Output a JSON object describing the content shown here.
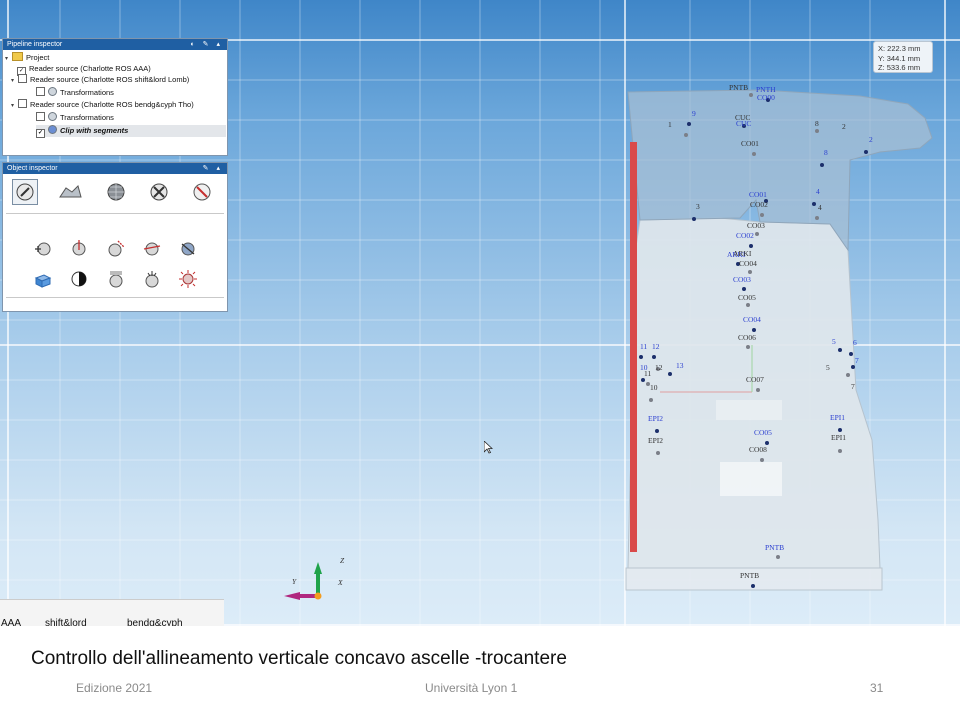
{
  "pipeline": {
    "title": "Pipeline inspector",
    "items": [
      {
        "label": "Project",
        "checked": false
      },
      {
        "label": "Reader source (Charlotte ROS AAA)",
        "checked": true
      },
      {
        "label": "Reader source (Charlotte ROS shift&lord Lomb)",
        "checked": false
      },
      {
        "label": "Transformations",
        "checked": false
      },
      {
        "label": "Reader source (Charlotte ROS bendg&cyph Tho)",
        "checked": false
      },
      {
        "label": "Transformations",
        "checked": false
      },
      {
        "label": "Clip with segments",
        "checked": true
      }
    ]
  },
  "object_inspector": {
    "title": "Object inspector"
  },
  "icons": {
    "object_tools": [
      "edit-icon",
      "surface-icon",
      "sphere-mesh-icon",
      "tools-icon",
      "forbidden-icon"
    ],
    "point_tools": [
      "add-point-icon",
      "axis-point-icon",
      "cut-point-icon",
      "plane-point-icon",
      "slice-point-icon",
      "box-icon",
      "contrast-icon",
      "label-point-icon",
      "time-point-icon",
      "burst-point-icon"
    ]
  },
  "coords": {
    "x": "X: 222.3 mm",
    "y": "Y: 344.1 mm",
    "z": "Z: 533.6 mm"
  },
  "axes": {
    "z": "Z",
    "y": "Y",
    "x": "X"
  },
  "labels": {
    "pntb_top": "PNTB",
    "pnth": "PNTH",
    "co00": "CO00",
    "cuc_blue": "CUC",
    "cuc_gray": "CUC",
    "n9": "9",
    "n1": "1",
    "co01_gray": "CO01",
    "n8_gray": "8",
    "n2_gray": "2",
    "n8_blue": "8",
    "n2_blue": "2",
    "n3": "3",
    "co01_blue": "CO01",
    "co02_gray": "CO02",
    "n4_blue": "4",
    "n4_gray": "4",
    "co03_gray": "CO03",
    "co02_blue": "CO02",
    "arki_blue": "ARKI",
    "arki_gray": "ARKI",
    "co04_gray": "CO04",
    "co03_blue": "CO03",
    "co05_gray": "CO05",
    "co04_blue": "CO04",
    "co06_gray": "CO06",
    "n5_blue": "5",
    "n6_blue": "6",
    "n7_blue": "7",
    "n5_gray": "5",
    "n7_gray": "7",
    "n11_blue": "11",
    "n12_blue": "12",
    "n12_gray": "12",
    "n13_blue": "13",
    "n10_blue": "10",
    "n11_gray": "11",
    "n10_gray": "10",
    "co07_gray": "CO07",
    "epi2_blue": "EPI2",
    "epi1_blue": "EPI1",
    "epi2_gray": "EPI2",
    "epi1_gray": "EPI1",
    "co05_blue": "CO05",
    "co08_gray": "CO08",
    "pntb_blue": "PNTB",
    "pntb_gray": "PNTB"
  },
  "legend_strip": [
    "AAA",
    "shift&lord",
    "bendg&cyph"
  ],
  "caption": "Controllo dell'allineamento verticale concavo ascelle -trocantere",
  "footer": {
    "left": "Edizione 2021",
    "center": "Università Lyon 1",
    "page": "31"
  },
  "colors": {
    "panel_title": "#1f5fa3",
    "red_bar": "#d94a4a",
    "blue_label": "#2b3fd0",
    "green_axis": "#1fa34a",
    "magenta_axis": "#b0287f"
  }
}
